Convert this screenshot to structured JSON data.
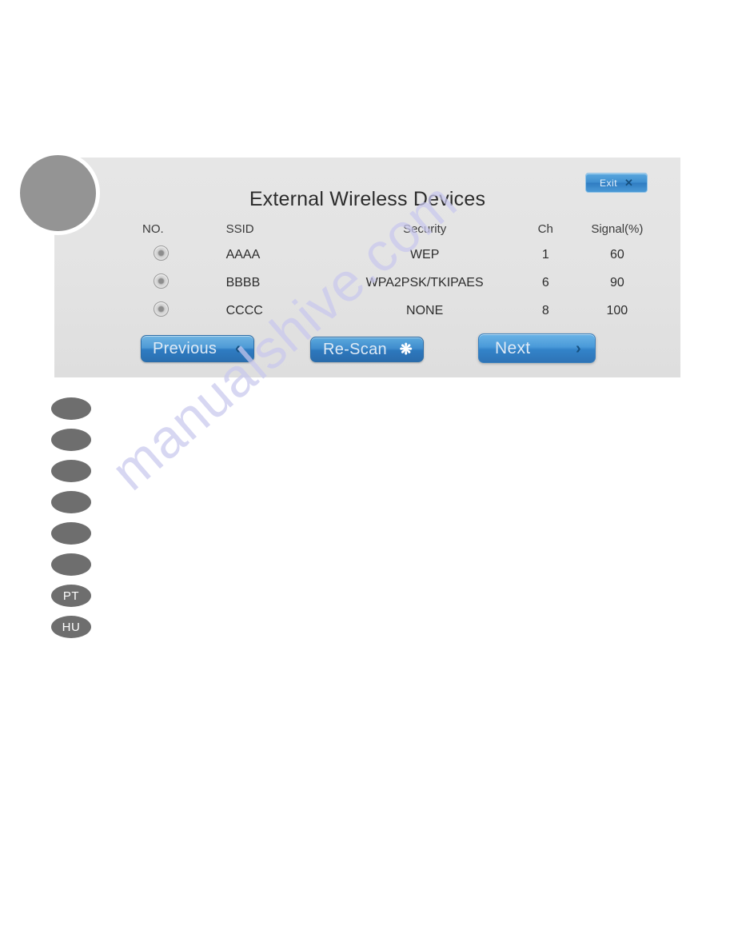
{
  "watermark": {
    "text": "manualshive.com"
  },
  "panel": {
    "title": "External Wireless Devices",
    "exit": {
      "label": "Exit",
      "glyph": "✕"
    },
    "table": {
      "headers": {
        "no": "NO.",
        "ssid": "SSID",
        "security": "Security",
        "ch": "Ch",
        "signal": "Signal(%)"
      },
      "rows": [
        {
          "ssid": "AAAA",
          "security": "WEP",
          "ch": "1",
          "signal": "60"
        },
        {
          "ssid": "BBBB",
          "security": "WPA2PSK/TKIPAES",
          "ch": "6",
          "signal": "90"
        },
        {
          "ssid": "CCCC",
          "security": "NONE",
          "ch": "8",
          "signal": "100"
        }
      ]
    },
    "buttons": {
      "previous": {
        "label": "Previous",
        "glyph": "‹"
      },
      "rescan": {
        "label": "Re-Scan",
        "glyph": "❋"
      },
      "next": {
        "label": "Next",
        "glyph": "›"
      }
    }
  },
  "language_rail": {
    "tabs": [
      {
        "label": ""
      },
      {
        "label": ""
      },
      {
        "label": ""
      },
      {
        "label": ""
      },
      {
        "label": ""
      },
      {
        "label": ""
      },
      {
        "label": "PT"
      },
      {
        "label": "HU"
      }
    ]
  },
  "colors": {
    "panel_bg": "#e4e4e4",
    "button_blue": "#3f8ccd",
    "tab_gray": "#6e6e6e",
    "watermark_purple": "#c9c8ee"
  }
}
